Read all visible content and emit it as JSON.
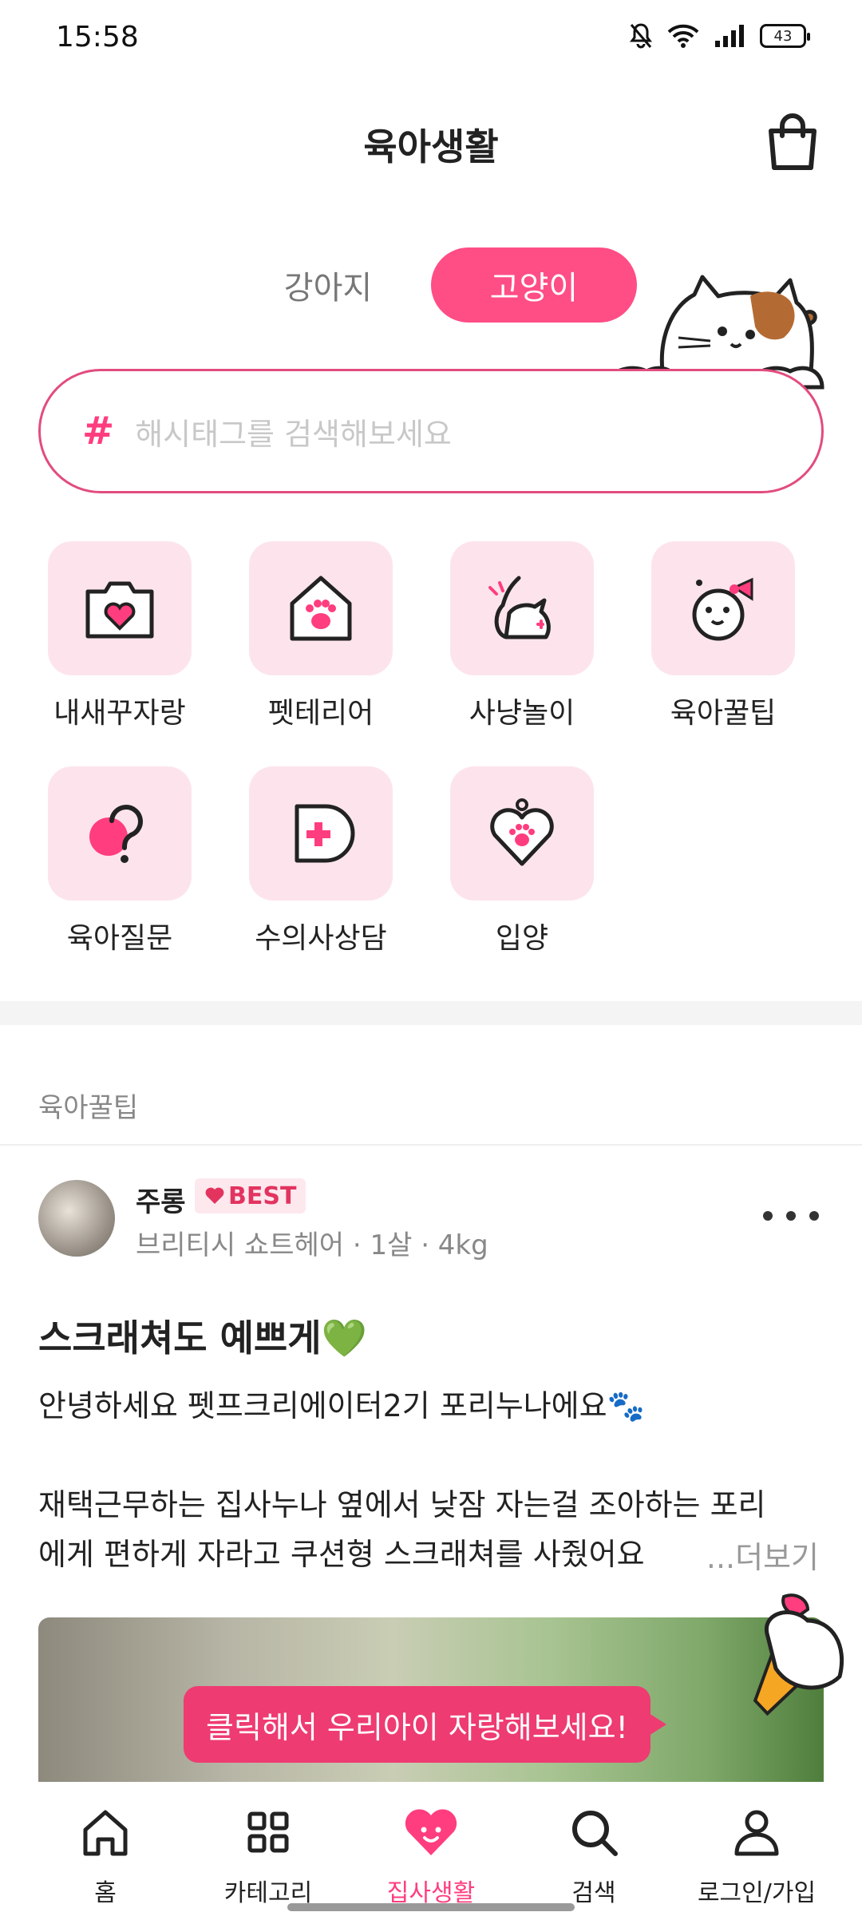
{
  "status_bar": {
    "time": "15:58",
    "battery": "43"
  },
  "header": {
    "title": "육아생활"
  },
  "tabs": [
    {
      "label": "강아지"
    },
    {
      "label": "고양이"
    }
  ],
  "search": {
    "hash": "#",
    "placeholder": "해시태그를 검색해보세요"
  },
  "categories": [
    {
      "label": "내새꾸자랑",
      "icon": "camera-heart-icon"
    },
    {
      "label": "펫테리어",
      "icon": "house-paw-icon"
    },
    {
      "label": "사냥놀이",
      "icon": "playing-cat-icon"
    },
    {
      "label": "육아꿀팁",
      "icon": "smiling-face-icon"
    },
    {
      "label": "육아질문",
      "icon": "question-icon"
    },
    {
      "label": "수의사상담",
      "icon": "medical-cross-icon"
    },
    {
      "label": "입양",
      "icon": "heart-paw-icon"
    }
  ],
  "section": {
    "label": "육아꿀팁"
  },
  "post": {
    "author": "주롱",
    "badge": "BEST",
    "meta": "브리티시 쇼트헤어 · 1살 · 4kg",
    "title": "스크래쳐도 예쁘게💚",
    "body_line1": "안녕하세요 펫프크리에이터2기 포리누나에요🐾",
    "body_line2": "재택근무하는 집사누나 옆에서 낮잠 자는걸 조아하는 포리",
    "body_line3": "에게 편하게 자라고 쿠션형 스크래쳐를 사줬어요",
    "read_more": "...더보기",
    "cta": "클릭해서 우리아이 자랑해보세요!"
  },
  "bottom_nav": [
    {
      "label": "홈",
      "icon": "home-icon"
    },
    {
      "label": "카테고리",
      "icon": "grid-icon"
    },
    {
      "label": "집사생활",
      "icon": "heart-face-icon",
      "active": true
    },
    {
      "label": "검색",
      "icon": "search-icon"
    },
    {
      "label": "로그인/가입",
      "icon": "person-icon"
    }
  ],
  "colors": {
    "accent": "#ff4d86",
    "tile": "#fde4ec",
    "best": "#e2345f"
  }
}
